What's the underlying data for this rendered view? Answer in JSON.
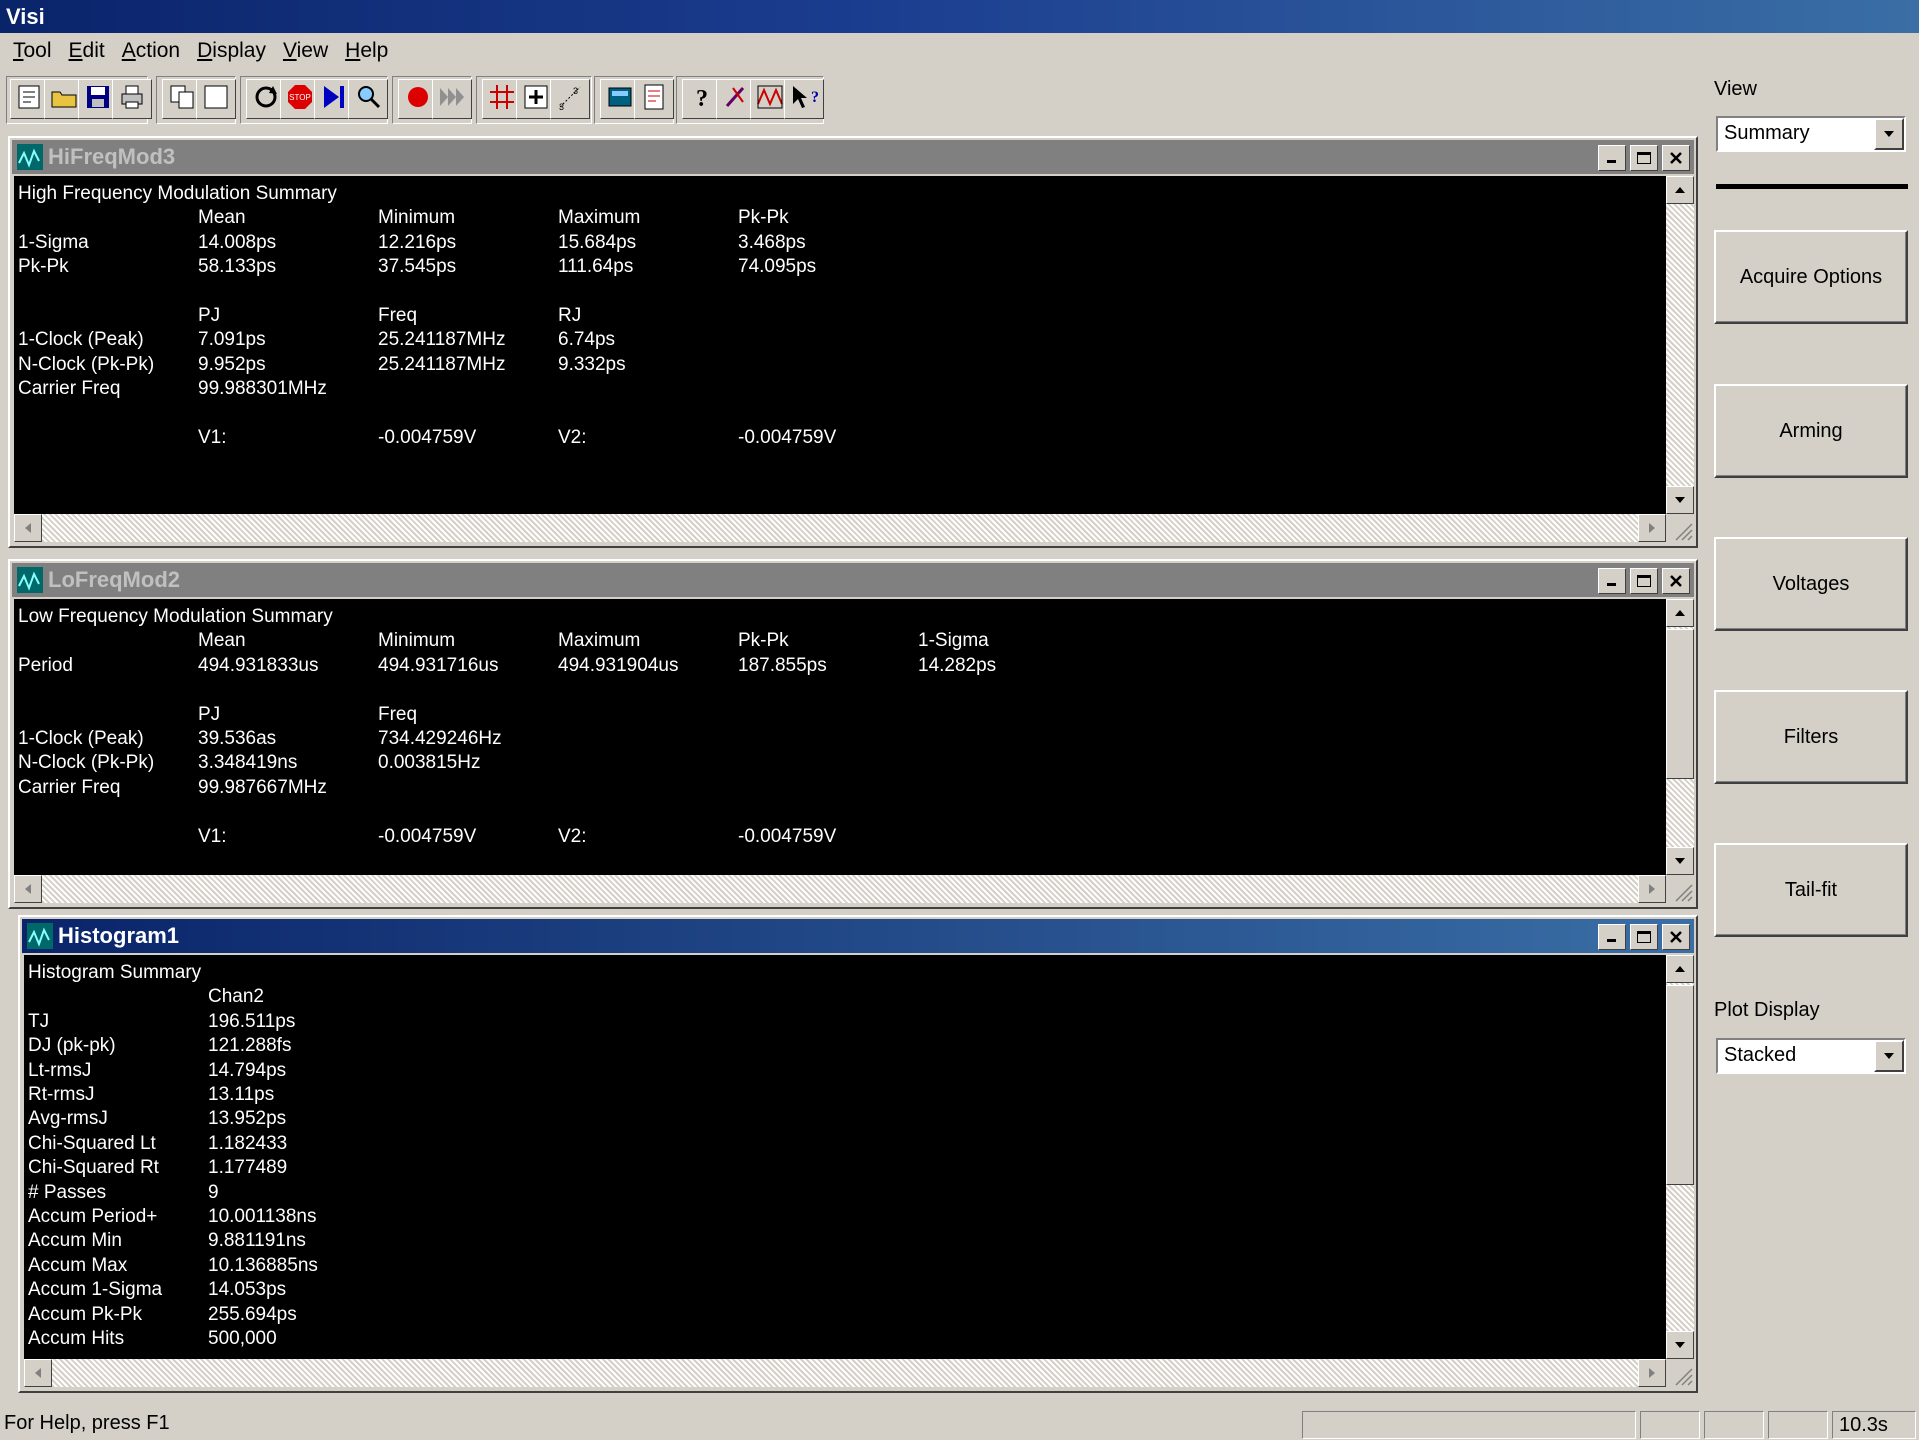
{
  "app": {
    "title": "Visi"
  },
  "menu": [
    {
      "underline": "T",
      "rest": "ool"
    },
    {
      "underline": "E",
      "rest": "dit"
    },
    {
      "underline": "A",
      "rest": "ction"
    },
    {
      "underline": "D",
      "rest": "isplay"
    },
    {
      "underline": "V",
      "rest": "iew"
    },
    {
      "underline": "H",
      "rest": "elp"
    }
  ],
  "toolbar_icons": [
    "new-tool-icon",
    "open-icon",
    "save-icon",
    "print-icon",
    "copy-icon",
    "blank-icon",
    "refresh-icon",
    "stop-icon",
    "step-icon",
    "zoom-icon",
    "record-icon",
    "fast-forward-icon",
    "grid-icon",
    "add-marker-icon",
    "scale-icon",
    "calculator-icon",
    "report-icon",
    "help-icon",
    "wizard-icon",
    "plot-icon",
    "context-help-icon"
  ],
  "right_panel": {
    "view_label": "View",
    "view_value": "Summary",
    "buttons": [
      "Acquire Options",
      "Arming",
      "Voltages",
      "Filters",
      "Tail-fit"
    ],
    "plot_display_label": "Plot Display",
    "plot_display_value": "Stacked"
  },
  "windows": {
    "hifreq": {
      "title": "HiFreqMod3",
      "lines": [
        [
          "High Frequency Modulation Summary"
        ],
        [
          "",
          "Mean",
          "Minimum",
          "Maximum",
          "Pk-Pk"
        ],
        [
          "1-Sigma",
          "14.008ps",
          "12.216ps",
          "15.684ps",
          "3.468ps"
        ],
        [
          "Pk-Pk",
          "58.133ps",
          "37.545ps",
          "111.64ps",
          "74.095ps"
        ],
        [
          ""
        ],
        [
          "",
          "PJ",
          "Freq",
          "RJ"
        ],
        [
          "1-Clock (Peak)",
          "7.091ps",
          "25.241187MHz",
          "6.74ps"
        ],
        [
          "N-Clock (Pk-Pk)",
          "9.952ps",
          "25.241187MHz",
          "9.332ps"
        ],
        [
          "Carrier Freq",
          "99.988301MHz"
        ],
        [
          ""
        ],
        [
          "",
          "V1:",
          "-0.004759V",
          "V2:",
          "-0.004759V"
        ]
      ]
    },
    "lofreq": {
      "title": "LoFreqMod2",
      "lines": [
        [
          "Low Frequency Modulation Summary"
        ],
        [
          "",
          "Mean",
          "Minimum",
          "Maximum",
          "Pk-Pk",
          "1-Sigma"
        ],
        [
          "Period",
          "494.931833us",
          "494.931716us",
          "494.931904us",
          "187.855ps",
          "14.282ps"
        ],
        [
          ""
        ],
        [
          "",
          "PJ",
          "Freq"
        ],
        [
          "1-Clock (Peak)",
          "39.536as",
          "734.429246Hz"
        ],
        [
          "N-Clock (Pk-Pk)",
          "3.348419ns",
          "0.003815Hz"
        ],
        [
          "Carrier Freq",
          "99.987667MHz"
        ],
        [
          ""
        ],
        [
          "",
          "V1:",
          "-0.004759V",
          "V2:",
          "-0.004759V"
        ]
      ]
    },
    "histogram": {
      "title": "Histogram1",
      "lines": [
        [
          "Histogram Summary"
        ],
        [
          "",
          "Chan2"
        ],
        [
          "TJ",
          "196.511ps"
        ],
        [
          "DJ (pk-pk)",
          "121.288fs"
        ],
        [
          "Lt-rmsJ",
          "14.794ps"
        ],
        [
          "Rt-rmsJ",
          "13.11ps"
        ],
        [
          "Avg-rmsJ",
          "13.952ps"
        ],
        [
          "Chi-Squared Lt",
          "1.182433"
        ],
        [
          "Chi-Squared Rt",
          "1.177489"
        ],
        [
          "# Passes",
          "9"
        ],
        [
          "Accum Period+",
          "10.001138ns"
        ],
        [
          "Accum Min",
          "9.881191ns"
        ],
        [
          "Accum Max",
          "10.136885ns"
        ],
        [
          "Accum 1-Sigma",
          "14.053ps"
        ],
        [
          "Accum Pk-Pk",
          "255.694ps"
        ],
        [
          "Accum Hits",
          "500,000"
        ]
      ]
    }
  },
  "status": {
    "help": "For Help, press F1",
    "time": "10.3s"
  }
}
